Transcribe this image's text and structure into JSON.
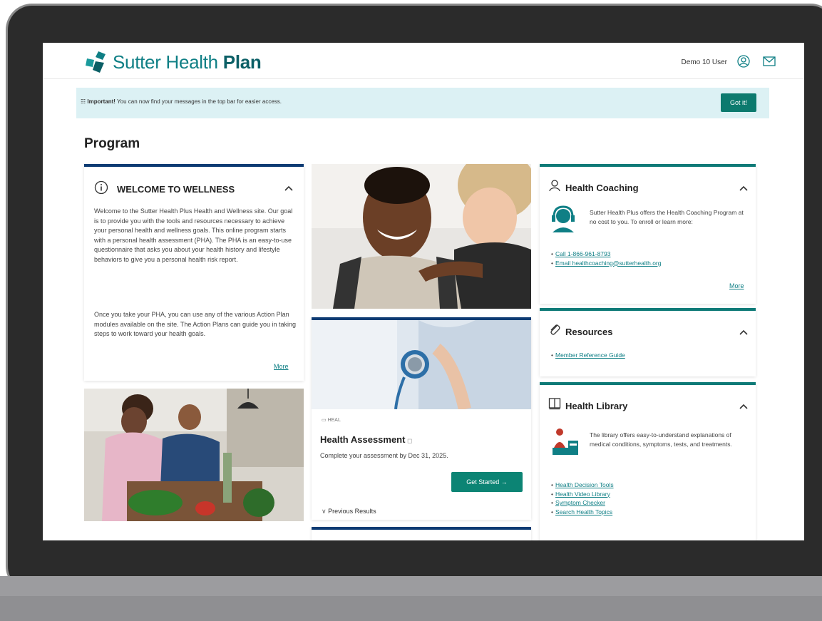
{
  "header": {
    "logo_text_light": "Sutter Health ",
    "logo_text_bold": "Plan",
    "user_name": "Demo 10 User",
    "brand_color": "#0f7f85"
  },
  "banner": {
    "label": "Important!",
    "message": " You can now find your messages in the top bar for easier access.",
    "button": "Got it!"
  },
  "page": {
    "title": "Program"
  },
  "welcome": {
    "title": "WELCOME TO WELLNESS",
    "paragraph1": "Welcome to the Sutter Health Plus Health and Wellness site. Our goal is to provide you with the tools and resources necessary to achieve your personal health and wellness goals. This online program starts with a personal health assessment (PHA). The PHA is an easy-to-use questionnaire that asks you about your health history and lifestyle behaviors to give you a personal health risk report.",
    "paragraph2": "Once you take your PHA, you can use any of the various Action Plan modules available on the site. The Action Plans can guide you in taking steps to work toward your health goals.",
    "more": "More"
  },
  "health_assessment": {
    "label": "HEAL",
    "title": "Health Assessment",
    "subtitle": "Complete your assessment by Dec 31, 2025.",
    "button": "Get Started",
    "previous": "Previous Results"
  },
  "health_coaching": {
    "title": "Health Coaching",
    "text": "Sutter Health Plus offers the Health Coaching Program at no cost to you. To enroll or learn more:",
    "links": [
      "Call 1-866-961-8793",
      "Email healthcoaching@sutterhealth.org"
    ],
    "more": "More"
  },
  "resources": {
    "title": "Resources",
    "links": [
      "Member Reference Guide"
    ]
  },
  "health_library": {
    "title": "Health Library",
    "text": "The library offers easy-to-understand explanations of medical conditions, symptoms, tests, and treatments.",
    "links": [
      "Health Decision Tools",
      "Health Video Library",
      "Symptom Checker",
      "Search Health Topics"
    ]
  }
}
